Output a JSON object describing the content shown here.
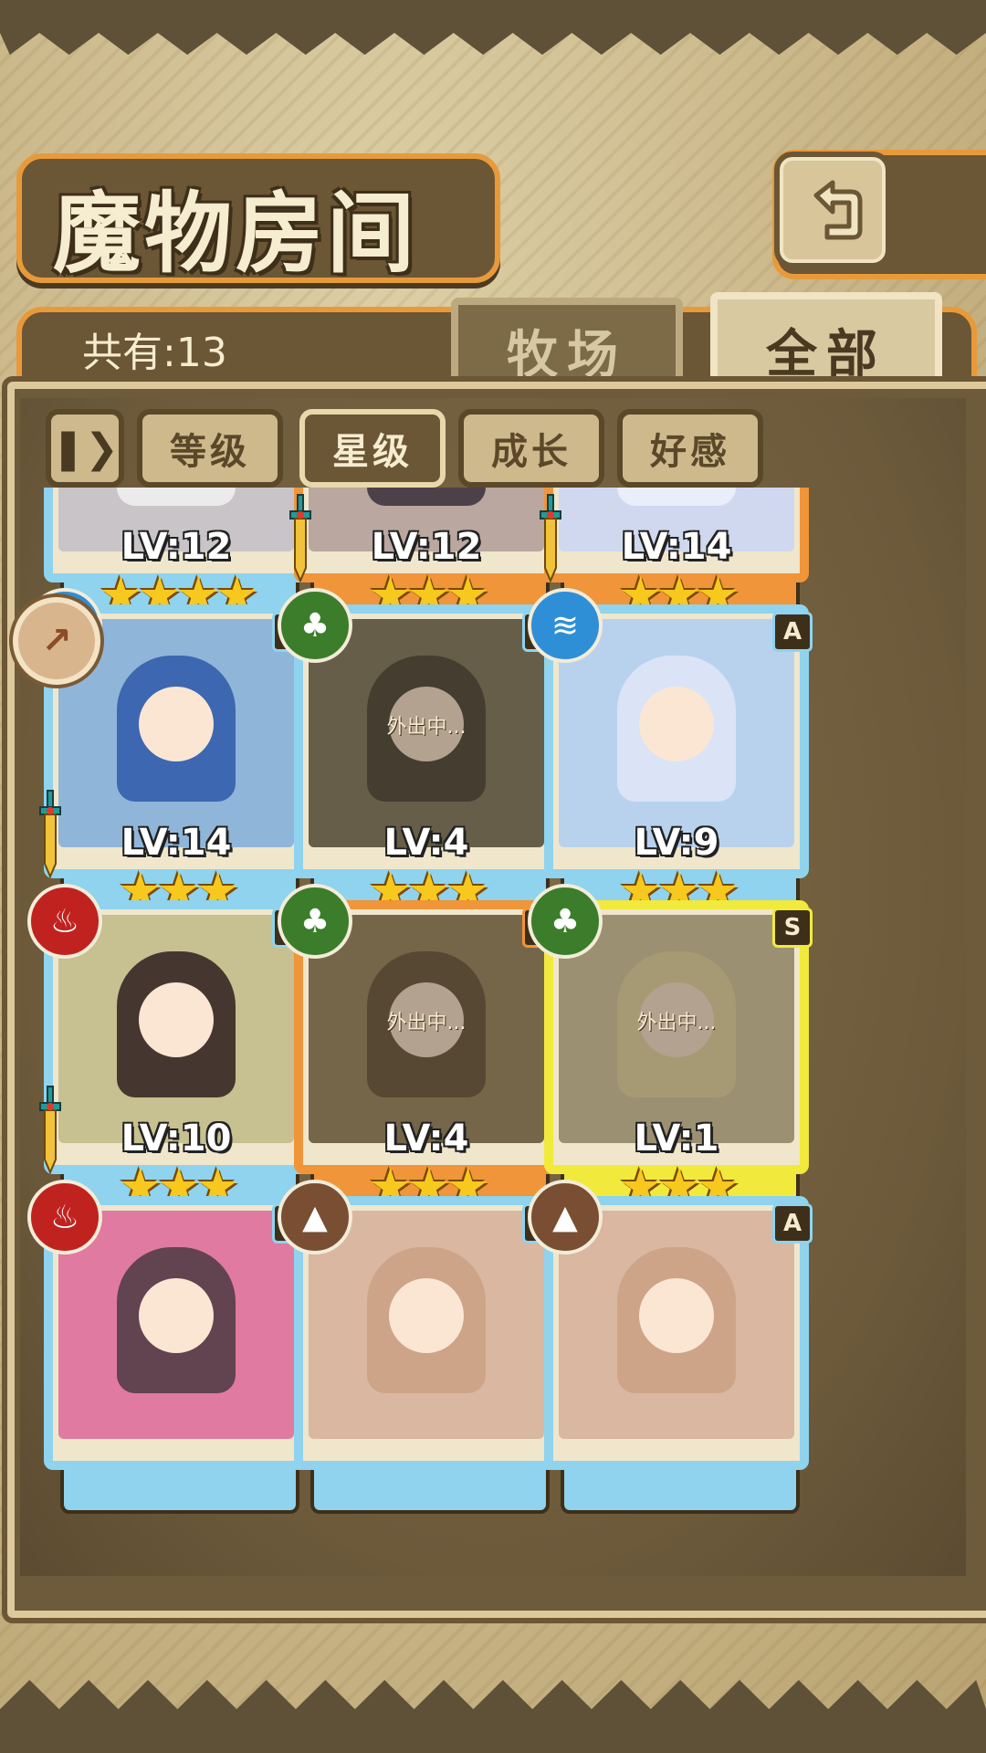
{
  "header": {
    "title": "魔物房间",
    "back_icon": "back-return-icon"
  },
  "toolbar": {
    "count_text": "共有:13",
    "tabs": [
      {
        "label": "牧场",
        "active": false
      },
      {
        "label": "全部",
        "active": true
      }
    ]
  },
  "filters": {
    "toggle_icon": "sort-toggle-icon",
    "items": [
      {
        "label": "等级",
        "active": false
      },
      {
        "label": "星级",
        "active": true
      },
      {
        "label": "成长",
        "active": false
      },
      {
        "label": "好感",
        "active": false
      }
    ]
  },
  "side_badge_icon": "side-arrow-icon",
  "colors": {
    "blue_frame": "#8fd3ee",
    "orange_frame": "#f0953a",
    "yellow_frame": "#f1ea3c"
  },
  "cards": [
    {
      "level": "LV:12",
      "stars": "★★★★",
      "frame": "blue",
      "rank": "",
      "element": "",
      "weapon": false,
      "away": ""
    },
    {
      "level": "LV:12",
      "stars": "★★★",
      "frame": "orange",
      "rank": "",
      "element": "",
      "weapon": true,
      "away": ""
    },
    {
      "level": "LV:14",
      "stars": "★★★",
      "frame": "orange",
      "rank": "",
      "element": "",
      "weapon": true,
      "away": ""
    },
    {
      "level": "LV:14",
      "stars": "★★★",
      "frame": "blue",
      "rank": "A",
      "element": "water",
      "weapon": true,
      "away": ""
    },
    {
      "level": "LV:4",
      "stars": "★★★",
      "frame": "blue",
      "rank": "A",
      "element": "nature",
      "weapon": false,
      "away": "外出中..."
    },
    {
      "level": "LV:9",
      "stars": "★★★",
      "frame": "blue",
      "rank": "A",
      "element": "water",
      "weapon": false,
      "away": ""
    },
    {
      "level": "LV:10",
      "stars": "★★★",
      "frame": "blue",
      "rank": "A",
      "element": "fire",
      "weapon": true,
      "away": ""
    },
    {
      "level": "LV:4",
      "stars": "★★★",
      "frame": "orange",
      "rank": "B",
      "element": "nature",
      "weapon": false,
      "away": "外出中..."
    },
    {
      "level": "LV:1",
      "stars": "★★★",
      "frame": "yellow",
      "rank": "S",
      "element": "nature",
      "weapon": false,
      "away": "外出中..."
    },
    {
      "level": "",
      "stars": "",
      "frame": "blue",
      "rank": "A",
      "element": "fire",
      "weapon": false,
      "away": ""
    },
    {
      "level": "",
      "stars": "",
      "frame": "blue",
      "rank": "A",
      "element": "earth",
      "weapon": false,
      "away": ""
    },
    {
      "level": "",
      "stars": "",
      "frame": "blue",
      "rank": "A",
      "element": "earth",
      "weapon": false,
      "away": ""
    }
  ]
}
